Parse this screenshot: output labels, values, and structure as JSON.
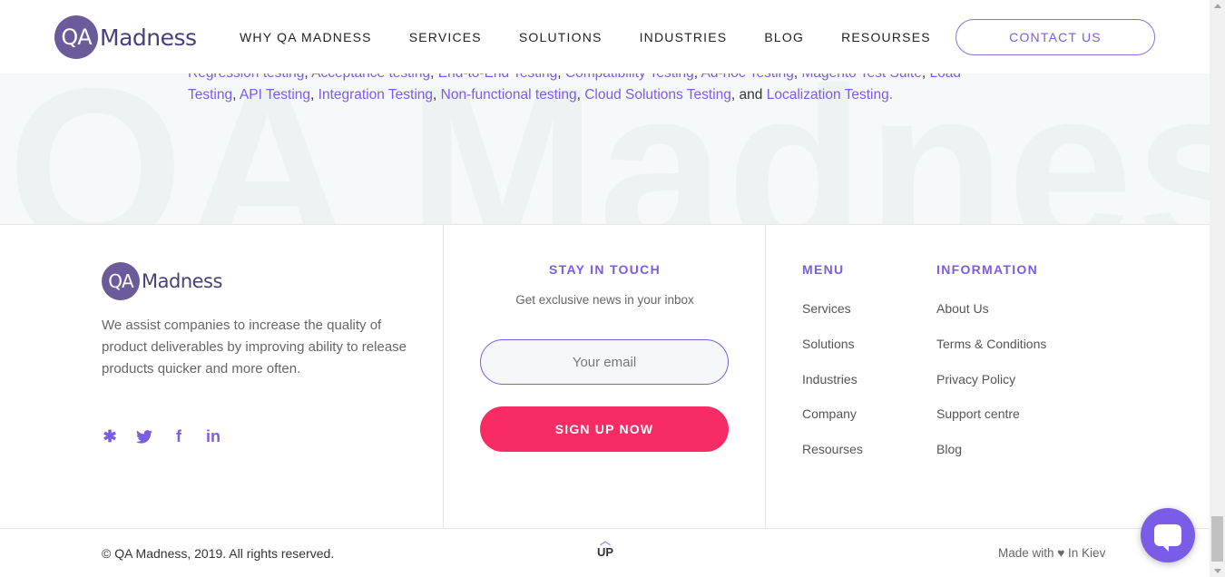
{
  "header": {
    "logo_mark": "QA",
    "logo_word": "Madness",
    "nav": [
      "WHY QA MADNESS",
      "SERVICES",
      "SOLUTIONS",
      "INDUSTRIES",
      "BLOG",
      "RESOURSES"
    ],
    "contact_label": "CONTACT US"
  },
  "band": {
    "watermark": "QA Madness",
    "line1": [
      "Regression testing",
      "Acceptance testing",
      "End-to-End Testing",
      "Compatibility Testing",
      "Ad-hoc Testing",
      "Magento Test Suite",
      "Load"
    ],
    "line2": [
      "Testing",
      "API Testing",
      "Integration Testing",
      "Non-functional testing",
      "Cloud Solutions Testing"
    ],
    "and_text": "and",
    "last_link": "Localization Testing",
    "end": "."
  },
  "footer": {
    "logo_mark": "QA",
    "logo_word": "Madness",
    "about": "We assist companies to increase the quality of product deliverables by improving ability to release products quicker and more often.",
    "social_icons": [
      "slack-icon",
      "twitter-icon",
      "facebook-icon",
      "linkedin-icon"
    ],
    "stay_title": "STAY IN TOUCH",
    "stay_sub": "Get exclusive news in your inbox",
    "email_placeholder": "Your email",
    "signup_label": "SIGN UP NOW",
    "menu_title": "MENU",
    "menu_items": [
      "Services",
      "Solutions",
      "Industries",
      "Company",
      "Resourses"
    ],
    "info_title": "INFORMATION",
    "info_items": [
      "About Us",
      "Terms & Conditions",
      "Privacy Policy",
      "Support centre",
      "Blog"
    ]
  },
  "bottom": {
    "copyright": "© QA Madness, 2019. All rights reserved.",
    "up_label": "UP",
    "made_with": "Made with ♥ In Kiev"
  },
  "colors": {
    "accent": "#7b5ce6",
    "signup": "#f72c65",
    "logo": "#6b5b9a"
  }
}
